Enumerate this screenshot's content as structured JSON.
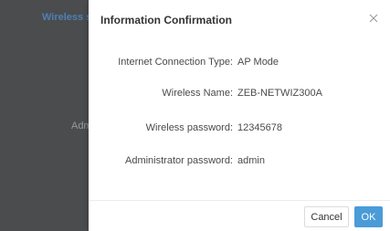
{
  "background": {
    "link_text": "Wireless s",
    "label_text": "Adm"
  },
  "dialog": {
    "title": "Information Confirmation",
    "close_icon": "close-icon",
    "rows": [
      {
        "label": "Internet Connection Type:",
        "value": "AP Mode"
      },
      {
        "label": "Wireless Name:",
        "value": "ZEB-NETWIZ300A"
      },
      {
        "label": "Wireless password:",
        "value": "12345678"
      },
      {
        "label": "Administrator password:",
        "value": "admin"
      }
    ],
    "cancel_label": "Cancel",
    "ok_label": "OK"
  },
  "colors": {
    "primary": "#4a9bd8",
    "overlay": "#4a4c4e",
    "text": "#4a4a4a"
  }
}
